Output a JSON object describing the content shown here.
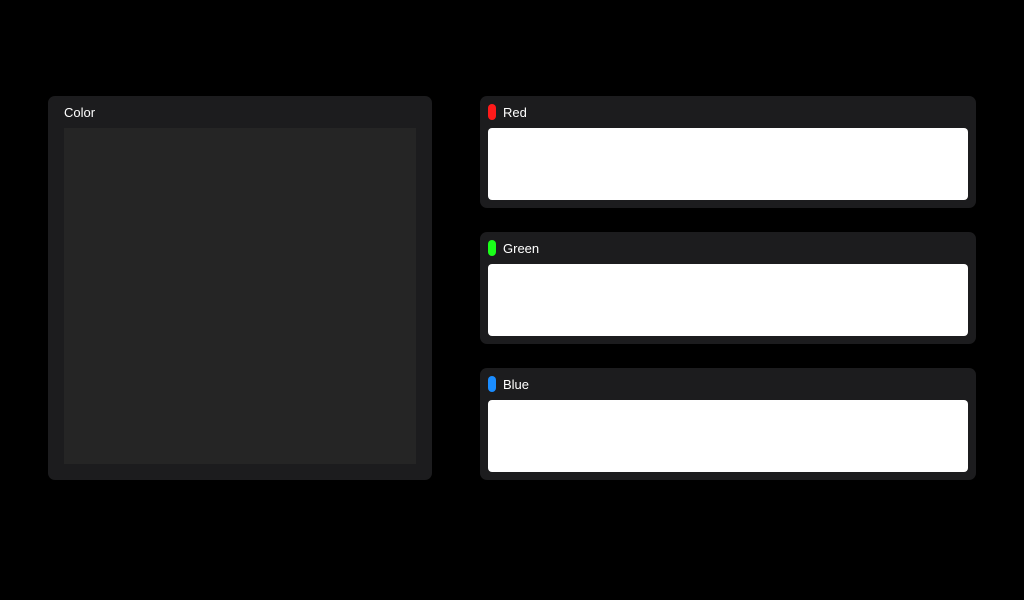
{
  "color_panel": {
    "title": "Color",
    "preview_color": "#252525"
  },
  "channels": [
    {
      "label": "Red",
      "indicator_color": "#ff1a1a",
      "value": "",
      "placeholder": ""
    },
    {
      "label": "Green",
      "indicator_color": "#1aff1a",
      "value": "",
      "placeholder": ""
    },
    {
      "label": "Blue",
      "indicator_color": "#1a8cff",
      "value": "",
      "placeholder": ""
    }
  ],
  "colors": {
    "background": "#000000",
    "panel": "#1c1c1e",
    "text": "#ffffff",
    "field": "#ffffff"
  }
}
